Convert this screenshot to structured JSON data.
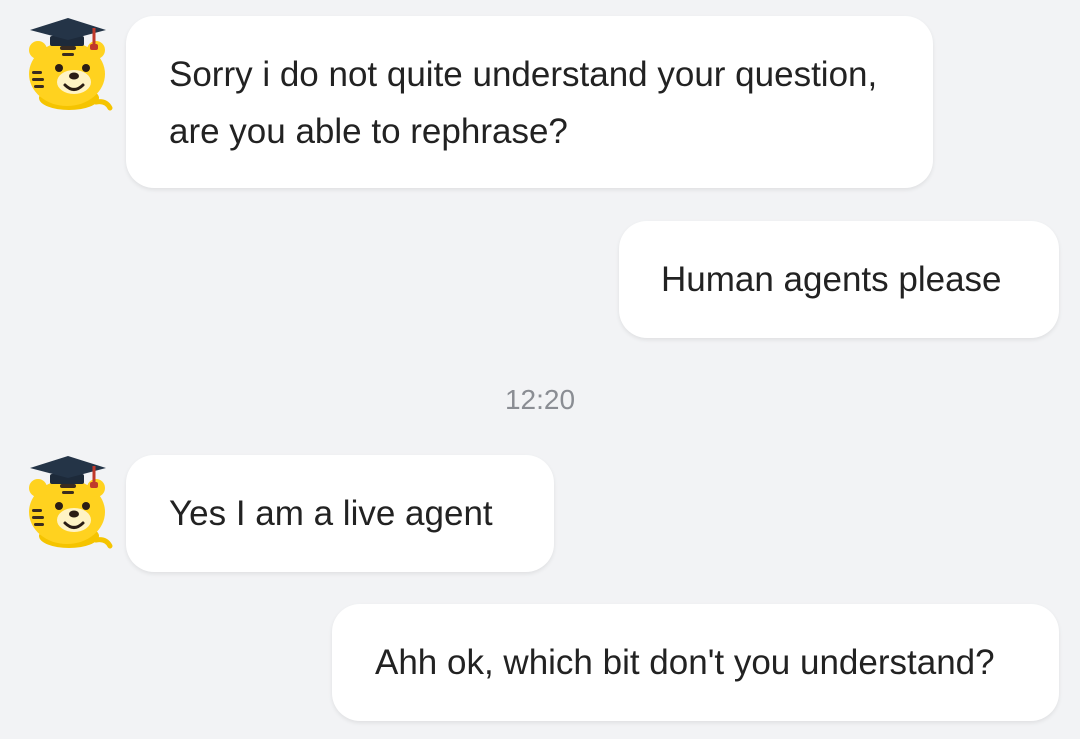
{
  "colors": {
    "background": "#f2f3f5",
    "bubble": "#ffffff",
    "text": "#222222",
    "timestamp": "#8a8d93"
  },
  "messages": [
    {
      "sender": "bot",
      "avatar_icon": "tiger-graduate-icon",
      "text": "Sorry i do not quite understand your question, are you able to rephrase?"
    },
    {
      "sender": "user",
      "text": "Human agents please"
    },
    {
      "type": "timestamp",
      "text": "12:20"
    },
    {
      "sender": "bot",
      "avatar_icon": "tiger-graduate-icon",
      "text": "Yes I am a live agent"
    },
    {
      "sender": "user",
      "text": "Ahh ok, which bit don't you understand?"
    }
  ]
}
